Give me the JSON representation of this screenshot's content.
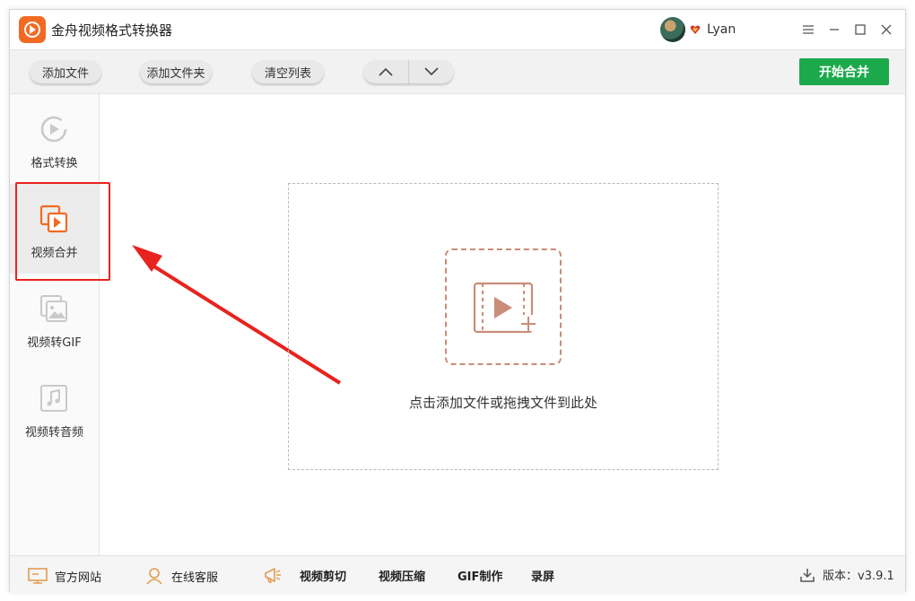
{
  "app": {
    "title": "金舟视频格式转换器"
  },
  "user": {
    "name": "Lyan"
  },
  "toolbar": {
    "add_file": "添加文件",
    "add_folder": "添加文件夹",
    "clear_list": "清空列表",
    "move_up": "︿",
    "move_down": "﹀",
    "start_merge": "开始合并"
  },
  "sidebar": {
    "items": [
      {
        "label": "格式转换",
        "icon": "format-convert-icon"
      },
      {
        "label": "视频合并",
        "icon": "video-merge-icon"
      },
      {
        "label": "视频转GIF",
        "icon": "video-to-gif-icon"
      },
      {
        "label": "视频转音频",
        "icon": "video-to-audio-icon"
      }
    ],
    "active_index": 1
  },
  "main": {
    "drop_hint": "点击添加文件或拖拽文件到此处"
  },
  "footer": {
    "website": "官方网站",
    "support": "在线客服",
    "video_cut": "视频剪切",
    "video_compress": "视频压缩",
    "gif_make": "GIF制作",
    "record": "录屏",
    "version_label": "版本：v3.9.1"
  },
  "colors": {
    "accent": "#1ba94c",
    "brand": "#f26a22",
    "highlight": "#e8231e",
    "icon_orange": "#f26a22"
  }
}
